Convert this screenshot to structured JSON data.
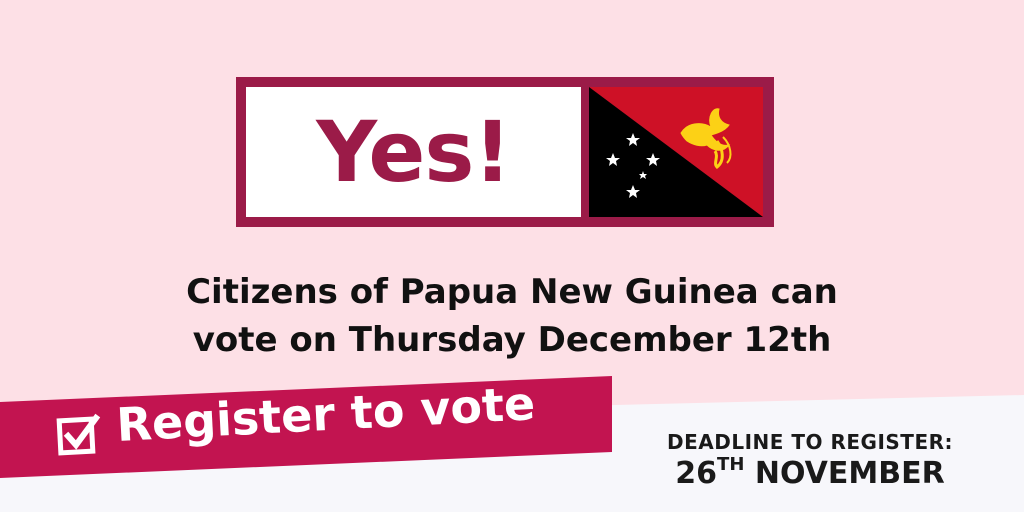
{
  "badge": {
    "yes_text": "Yes!"
  },
  "headline": {
    "line1": "Citizens of Papua New Guinea can",
    "line2": "vote on Thursday December 12th"
  },
  "register": {
    "label": "Register to vote",
    "icon": "checkbox-icon"
  },
  "deadline": {
    "line1": "DEADLINE TO REGISTER:",
    "day": "26",
    "suffix": "TH",
    "month": "NOVEMBER"
  },
  "colors": {
    "background_pink": "#fde0e6",
    "background_white": "#f7f7fb",
    "brand_maroon": "#9b1b48",
    "banner_crimson": "#c21450",
    "flag_red": "#ce1126",
    "flag_black": "#000000",
    "flag_gold": "#fcd116"
  }
}
